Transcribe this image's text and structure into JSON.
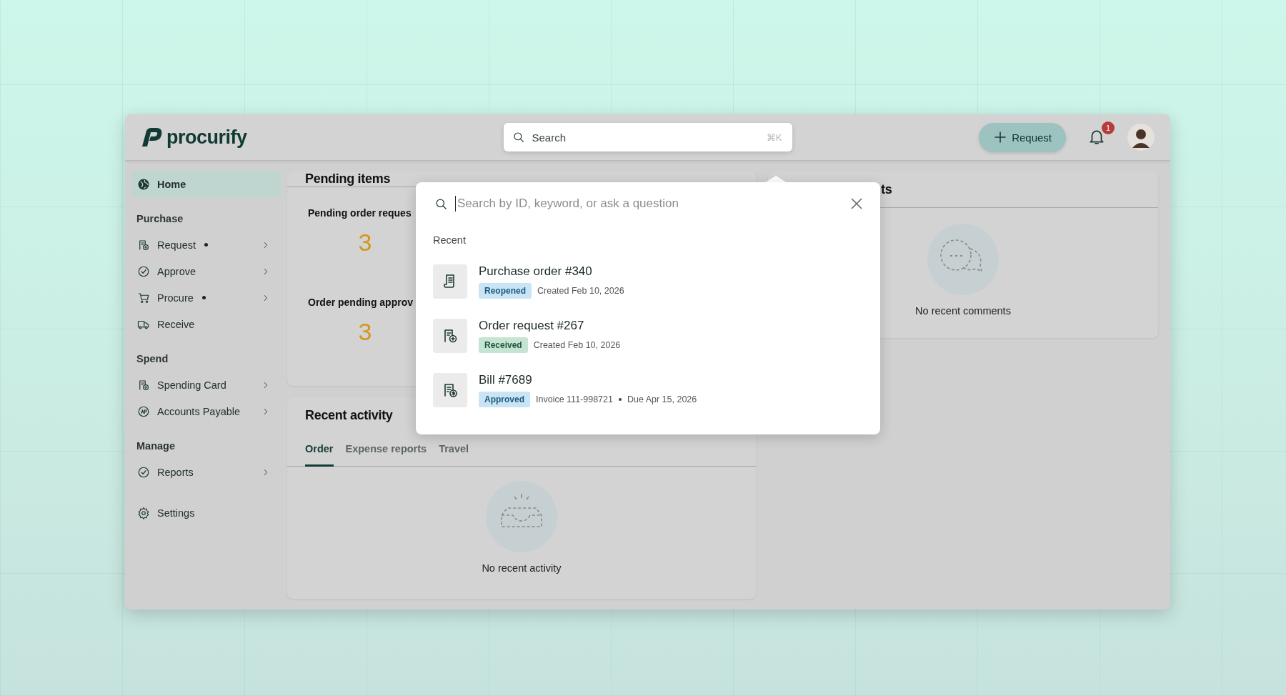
{
  "header": {
    "logo": "procurify",
    "search": {
      "placeholder": "Search",
      "shortcut": "⌘K"
    },
    "request_button": "Request",
    "notifications": "1"
  },
  "sidebar": {
    "home": {
      "label": "Home",
      "selected": true
    },
    "sections": [
      {
        "title": "Purchase",
        "items": [
          {
            "label": "Request",
            "dot": true,
            "expandable": true
          },
          {
            "label": "Approve",
            "dot": false,
            "expandable": true
          },
          {
            "label": "Procure",
            "dot": true,
            "expandable": true
          },
          {
            "label": "Receive",
            "dot": false,
            "expandable": false
          }
        ]
      },
      {
        "title": "Spend",
        "items": [
          {
            "label": "Spending Card",
            "dot": false,
            "expandable": true
          },
          {
            "label": "Accounts Payable",
            "dot": false,
            "expandable": true
          }
        ]
      },
      {
        "title": "Manage",
        "items": [
          {
            "label": "Reports",
            "dot": false,
            "expandable": true
          }
        ]
      }
    ],
    "settings": {
      "label": "Settings"
    }
  },
  "pending_items": {
    "title": "Pending items",
    "metrics": [
      {
        "label": "Pending order reques",
        "value": "3"
      },
      {
        "label": "Order pending approv",
        "value": "3"
      }
    ]
  },
  "recent_activity": {
    "title": "Recent activity",
    "tabs": [
      {
        "label": "Order",
        "selected": true
      },
      {
        "label": "Expense reports",
        "selected": false
      },
      {
        "label": "Travel",
        "selected": false
      }
    ],
    "empty": "No recent activity"
  },
  "comments_card": {
    "title": "ts",
    "empty": "No recent comments"
  },
  "search_popup": {
    "placeholder": "Search by ID, keyword, or ask a question",
    "recent_label": "Recent",
    "results": [
      {
        "title": "Purchase order #340",
        "status": {
          "label": "Reopened",
          "kind": "info"
        },
        "meta": [
          "Created Feb 10, 2026"
        ]
      },
      {
        "title": "Order request #267",
        "status": {
          "label": "Received",
          "kind": "success"
        },
        "meta": [
          "Created Feb 10, 2026"
        ]
      },
      {
        "title": "Bill #7689",
        "status": {
          "label": "Approved",
          "kind": "info"
        },
        "meta": [
          "Invoice 111-998721",
          "Due Apr 15, 2026"
        ]
      }
    ]
  }
}
